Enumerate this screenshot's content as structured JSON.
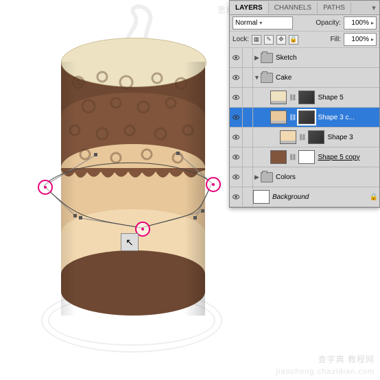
{
  "attribution": {
    "top": "思缘设计论坛  WWW.MISSYUAN.COM",
    "bottom1": "查字典 教程网",
    "bottom2": "jiaocheng.chazidian.com"
  },
  "panel": {
    "tabs": {
      "layers": "LAYERS",
      "channels": "CHANNELS",
      "paths": "PATHS"
    },
    "blend_mode": "Normal",
    "opacity_label": "Opacity:",
    "opacity_value": "100%",
    "lock_label": "Lock:",
    "fill_label": "Fill:",
    "fill_value": "100%",
    "lock_icons": {
      "pixels": "▦",
      "position": "✎",
      "move": "✥",
      "all": "🔒"
    }
  },
  "layers": [
    {
      "kind": "group",
      "name": "Sketch",
      "indent": 0,
      "expanded": false,
      "thumb_color": "#b6b6b6"
    },
    {
      "kind": "group",
      "name": "Cake",
      "indent": 0,
      "expanded": true,
      "thumb_color": "#b6b6b6"
    },
    {
      "kind": "shape",
      "name": "Shape 5",
      "indent": 1,
      "thumb_color": "#eee2c0",
      "mask": true,
      "smart": true
    },
    {
      "kind": "shape",
      "name": "Shape 3 c...",
      "indent": 1,
      "thumb_color": "#e9c99c",
      "mask": true,
      "smart": true,
      "selected": true
    },
    {
      "kind": "shape",
      "name": "Shape 3",
      "indent": 2,
      "thumb_color": "#f2d9b1",
      "mask": true,
      "smart": true
    },
    {
      "kind": "shape",
      "name": "Shape 5 copy",
      "indent": 1,
      "thumb_color": "#80553c",
      "mask": true,
      "mask_white": true,
      "underline": true
    },
    {
      "kind": "group",
      "name": "Colors",
      "indent": 0,
      "expanded": false,
      "thumb_color": "#b6b6b6"
    },
    {
      "kind": "bg",
      "name": "Background",
      "indent": 0,
      "thumb_color": "#ffffff",
      "locked": true,
      "italic": true
    }
  ],
  "tool_cursor_glyph": "↖"
}
